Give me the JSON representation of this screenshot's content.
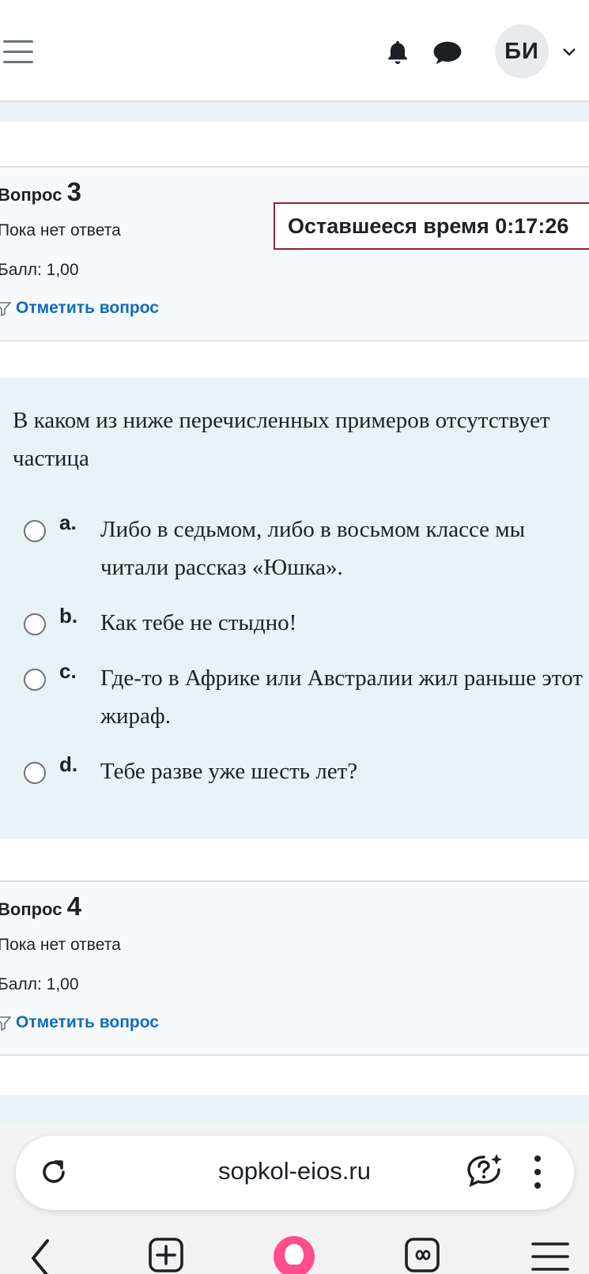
{
  "header": {
    "avatar_initials": "БИ",
    "icons": [
      "hamburger-menu-icon",
      "bell-icon",
      "chat-icon",
      "chevron-down-icon"
    ]
  },
  "question3": {
    "label": "Вопрос",
    "number": "3",
    "state": "Пока нет ответа",
    "grade": "Балл: 1,00",
    "flag_label": "Отметить вопрос"
  },
  "timer": {
    "text": "Оставшееся время 0:17:26"
  },
  "question_text": {
    "prompt": "В каком из ниже перечисленных примеров отсутствует частица",
    "answers": [
      {
        "letter": "a.",
        "text": "Либо в седьмом, либо в восьмом классе мы читали рассказ «Юшка»."
      },
      {
        "letter": "b.",
        "text": "Как тебе не стыдно!"
      },
      {
        "letter": "c.",
        "text": "Где-то в Африке или Австралии жил раньше этот жираф."
      },
      {
        "letter": "d.",
        "text": "Тебе разве уже шесть лет?"
      }
    ]
  },
  "question4": {
    "label": "Вопрос",
    "number": "4",
    "state": "Пока нет ответа",
    "grade": "Балл: 1,00",
    "flag_label": "Отметить вопрос"
  },
  "browser": {
    "url": "sopkol-eios.ru",
    "icons": [
      "reload-icon",
      "assistant-icon",
      "more-icon",
      "back-icon",
      "new-tab-icon",
      "alice-icon",
      "tabs-icon",
      "menu-icon"
    ]
  },
  "colors": {
    "link": "#0f6cbf",
    "timer_border": "#8b2a2a",
    "question_bg": "#e7f3f5",
    "info_bg": "#f8f9fa",
    "alice_accent": "#ff4d8d"
  }
}
